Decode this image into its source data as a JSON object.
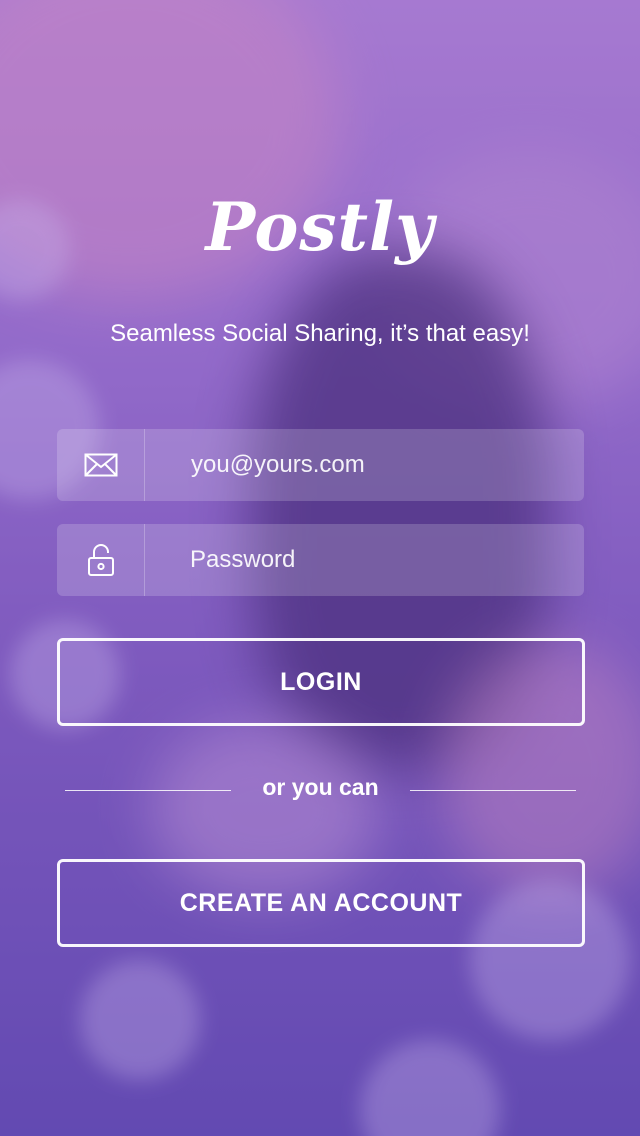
{
  "app": {
    "logo_text": "Postly",
    "tagline": "Seamless Social Sharing, it’s that easy!"
  },
  "form": {
    "email": {
      "icon": "envelope-icon",
      "placeholder": "you@yours.com",
      "value": ""
    },
    "password": {
      "icon": "unlock-icon",
      "placeholder": "Password",
      "value": ""
    }
  },
  "buttons": {
    "login_label": "LOGIN",
    "create_account_label": "CREATE AN ACCOUNT"
  },
  "divider": {
    "text": "or you can"
  },
  "colors": {
    "overlay": "#7f5dbd",
    "text": "#ffffff"
  }
}
